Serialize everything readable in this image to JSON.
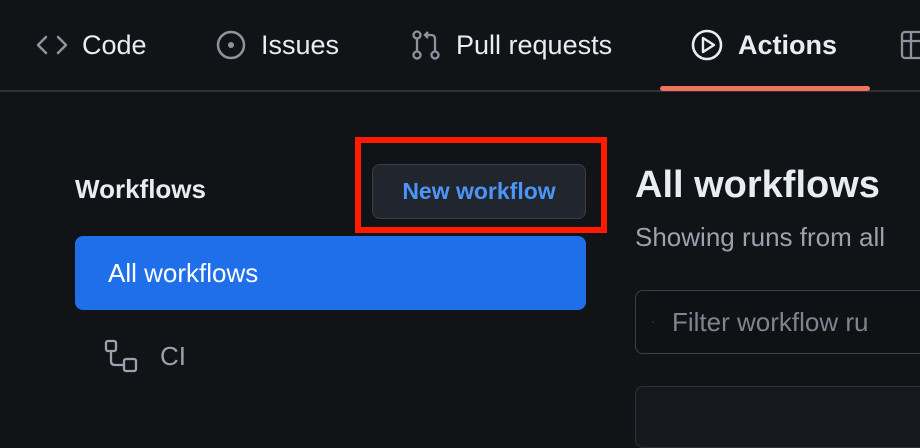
{
  "repo_nav": {
    "tabs": [
      {
        "label": "Code",
        "icon": "code-icon"
      },
      {
        "label": "Issues",
        "icon": "issue-icon"
      },
      {
        "label": "Pull requests",
        "icon": "pull-request-icon"
      },
      {
        "label": "Actions",
        "icon": "play-icon",
        "selected": true
      },
      {
        "label": "",
        "icon": "table-icon"
      }
    ],
    "selected_underline_color": "#f0735b"
  },
  "sidebar": {
    "heading": "Workflows",
    "new_workflow_label": "New workflow",
    "items": [
      {
        "label": "All workflows",
        "active": true
      },
      {
        "label": "CI",
        "icon": "workflow-icon"
      }
    ],
    "highlight_color": "#ff1a00"
  },
  "main": {
    "title": "All workflows",
    "subtitle": "Showing runs from all",
    "filter_placeholder": "Filter workflow ru",
    "search_icon": "search-icon"
  },
  "colors": {
    "background": "#121317",
    "accent": "#1f6feb",
    "link": "#4c95f7"
  }
}
